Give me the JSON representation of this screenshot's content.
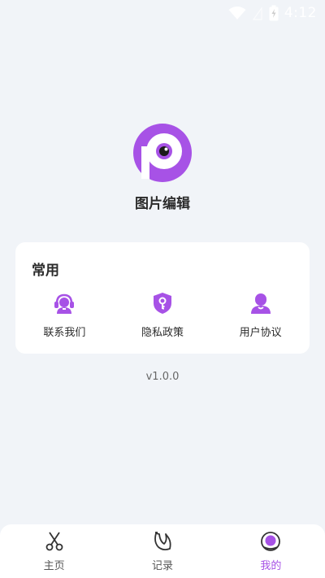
{
  "status_bar": {
    "time": "4:12"
  },
  "app": {
    "name": "图片编辑",
    "version": "v1.0.0"
  },
  "common_card": {
    "title": "常用",
    "items": [
      {
        "label": "联系我们",
        "icon": "headset-icon"
      },
      {
        "label": "隐私政策",
        "icon": "shield-key-icon"
      },
      {
        "label": "用户协议",
        "icon": "user-icon"
      }
    ]
  },
  "tabs": [
    {
      "label": "主页",
      "icon": "scissors-icon",
      "active": false
    },
    {
      "label": "记录",
      "icon": "banana-icon",
      "active": false
    },
    {
      "label": "我的",
      "icon": "profile-icon",
      "active": true
    }
  ],
  "colors": {
    "accent": "#a752e6",
    "background": "#f1f4f8",
    "card": "#ffffff"
  }
}
